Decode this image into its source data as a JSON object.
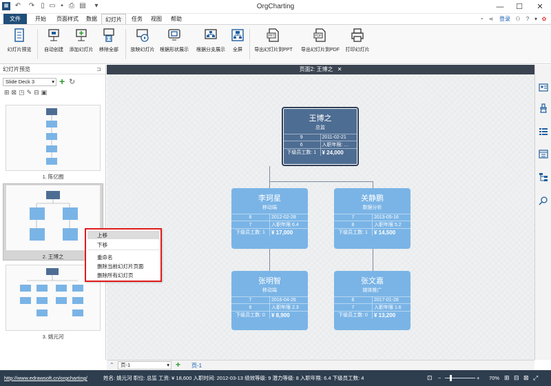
{
  "app": {
    "title": "OrgCharting"
  },
  "header": {
    "login": "登录"
  },
  "menu": {
    "tabs": [
      "文件",
      "开始",
      "页面样式",
      "数据",
      "幻灯片",
      "任务",
      "视图",
      "帮助"
    ],
    "active": "幻灯片"
  },
  "ribbon": {
    "buttons": [
      "幻灯片预览",
      "自动创建",
      "添加幻灯片",
      "移除全部",
      "放映幻灯片",
      "根据形状展示",
      "根据分支展示",
      "全屏",
      "导出幻灯片到PPT",
      "导出幻灯片到PDF",
      "打印幻灯片"
    ]
  },
  "left_panel": {
    "title": "幻灯片预览",
    "deck_select": "Slide Deck 3",
    "slides": [
      "1. 陈亿囿",
      "2. 王博之",
      "3. 姚元河"
    ]
  },
  "context_menu": {
    "items": [
      "上移",
      "下移",
      "重命名",
      "删除当前幻灯片页面",
      "删除所有幻灯页"
    ]
  },
  "canvas": {
    "tab_title": "页面2: 王博之"
  },
  "cards": {
    "root": {
      "name": "王博之",
      "title": "总监",
      "r1l": "9",
      "r1r": "2011-02-21",
      "r2l": "6",
      "r2r": "入职年限: …",
      "r3l": "下级员工数: 1",
      "r3r": "¥ 24,000"
    },
    "c1": {
      "name": "李珂星",
      "title": "移动端",
      "r1l": "8",
      "r1r": "2012-02-28",
      "r2l": "7",
      "r2r": "入职年限 6.4",
      "r3l": "下级员工数: 1",
      "r3r": "¥ 17,000"
    },
    "c2": {
      "name": "关静鹏",
      "title": "数据分析",
      "r1l": "7",
      "r1r": "2013-05-16",
      "r2l": "8",
      "r2r": "入职年限 5.2",
      "r3l": "下级员工数: 1",
      "r3r": "¥ 14,500"
    },
    "c3": {
      "name": "张明智",
      "title": "移动端",
      "r1l": "7",
      "r1r": "2016-04-26",
      "r2l": "6",
      "r2r": "入职年限 2.3",
      "r3l": "下级员工数: 0",
      "r3r": "¥ 8,900"
    },
    "c4": {
      "name": "张文嘉",
      "title": "媒体推广",
      "r1l": "6",
      "r1r": "2017-01-28",
      "r2l": "7",
      "r2r": "入职年限 1.6",
      "r3l": "下级员工数: 0",
      "r3r": "¥ 13,200"
    }
  },
  "page_bar": {
    "page_select": "页-1",
    "page_tab": "页-1"
  },
  "status": {
    "url": "http://www.edrawsoft.cn/orgcharting/",
    "info": "姓名: 姚元河  职位: 总监  工资: ¥ 18,600  入职时间: 2012-03-13  绩效等级: 9  潜力等级: 8  入职年限: 6.4  下级员工数: 4",
    "zoom": "70%"
  },
  "colors": {
    "root": "#4e6d93",
    "child": "#7ab4e6",
    "accent": "#1f4e79",
    "context_border": "#e01b1b"
  }
}
